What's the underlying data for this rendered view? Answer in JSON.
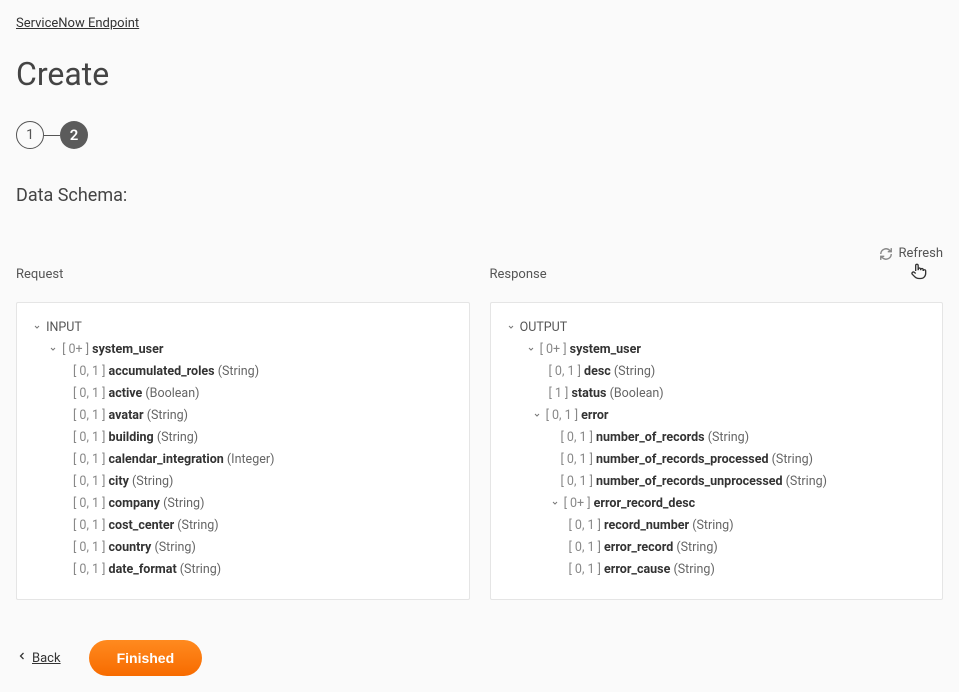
{
  "breadcrumb": {
    "endpoint": "ServiceNow Endpoint"
  },
  "title": "Create",
  "steps": {
    "step1": "1",
    "step2": "2"
  },
  "section_title": "Data Schema:",
  "refresh_label": "Refresh",
  "panel": {
    "request_label": "Request",
    "response_label": "Response"
  },
  "request_tree": {
    "root": "INPUT",
    "system_user": {
      "card": "[ 0+ ]",
      "name": "system_user"
    },
    "fields": [
      {
        "card": "[ 0, 1 ]",
        "name": "accumulated_roles",
        "type": "(String)"
      },
      {
        "card": "[ 0, 1 ]",
        "name": "active",
        "type": "(Boolean)"
      },
      {
        "card": "[ 0, 1 ]",
        "name": "avatar",
        "type": "(String)"
      },
      {
        "card": "[ 0, 1 ]",
        "name": "building",
        "type": "(String)"
      },
      {
        "card": "[ 0, 1 ]",
        "name": "calendar_integration",
        "type": "(Integer)"
      },
      {
        "card": "[ 0, 1 ]",
        "name": "city",
        "type": "(String)"
      },
      {
        "card": "[ 0, 1 ]",
        "name": "company",
        "type": "(String)"
      },
      {
        "card": "[ 0, 1 ]",
        "name": "cost_center",
        "type": "(String)"
      },
      {
        "card": "[ 0, 1 ]",
        "name": "country",
        "type": "(String)"
      },
      {
        "card": "[ 0, 1 ]",
        "name": "date_format",
        "type": "(String)"
      }
    ]
  },
  "response_tree": {
    "root": "OUTPUT",
    "system_user": {
      "card": "[ 0+ ]",
      "name": "system_user"
    },
    "desc": {
      "card": "[ 0, 1 ]",
      "name": "desc",
      "type": "(String)"
    },
    "status": {
      "card": "[ 1 ]",
      "name": "status",
      "type": "(Boolean)"
    },
    "error": {
      "card": "[ 0, 1 ]",
      "name": "error"
    },
    "error_fields": [
      {
        "card": "[ 0, 1 ]",
        "name": "number_of_records",
        "type": "(String)"
      },
      {
        "card": "[ 0, 1 ]",
        "name": "number_of_records_processed",
        "type": "(String)"
      },
      {
        "card": "[ 0, 1 ]",
        "name": "number_of_records_unprocessed",
        "type": "(String)"
      }
    ],
    "error_record_desc": {
      "card": "[ 0+ ]",
      "name": "error_record_desc"
    },
    "error_record_fields": [
      {
        "card": "[ 0, 1 ]",
        "name": "record_number",
        "type": "(String)"
      },
      {
        "card": "[ 0, 1 ]",
        "name": "error_record",
        "type": "(String)"
      },
      {
        "card": "[ 0, 1 ]",
        "name": "error_cause",
        "type": "(String)"
      }
    ]
  },
  "footer": {
    "back": "Back",
    "finished": "Finished"
  }
}
